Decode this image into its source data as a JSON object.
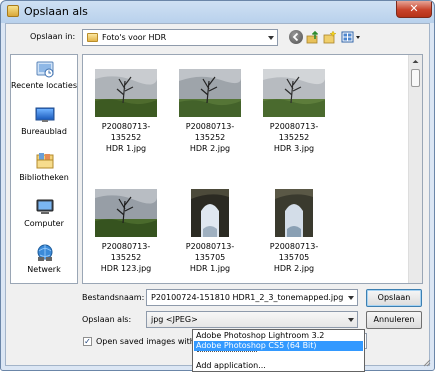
{
  "window": {
    "title": "Opslaan als",
    "close_label": "✕"
  },
  "toolbar": {
    "save_in_label": "Opslaan in:",
    "save_in_value": "Foto's voor HDR"
  },
  "places": [
    {
      "label": "Recente locaties",
      "icon": "recent-places-icon"
    },
    {
      "label": "Bureaublad",
      "icon": "desktop-icon"
    },
    {
      "label": "Bibliotheken",
      "icon": "libraries-icon"
    },
    {
      "label": "Computer",
      "icon": "computer-icon"
    },
    {
      "label": "Netwerk",
      "icon": "network-icon"
    }
  ],
  "files": [
    {
      "line1": "P20080713-135252",
      "line2": "HDR 1.jpg",
      "kind": "tree"
    },
    {
      "line1": "P20080713-135252",
      "line2": "HDR 2.jpg",
      "kind": "tree"
    },
    {
      "line1": "P20080713-135252",
      "line2": "HDR 3.jpg",
      "kind": "tree"
    },
    {
      "line1": "P20080713-135252",
      "line2": "HDR 123.jpg",
      "kind": "tree"
    },
    {
      "line1": "P20080713-135705",
      "line2": "HDR 1.jpg",
      "kind": "arch"
    },
    {
      "line1": "P20080713-135705",
      "line2": "HDR 2.jpg",
      "kind": "arch"
    }
  ],
  "form": {
    "filename_label": "Bestandsnaam:",
    "filename_value": "P20100724-151810 HDR1_2_3_tonemapped.jpg",
    "type_label": "Opslaan als:",
    "type_value": "jpg <JPEG>",
    "save_button": "Opslaan",
    "cancel_button": "Annuleren",
    "open_checkbox_label": "Open saved images with:",
    "open_checked": true
  },
  "dropdown": {
    "items": [
      "Adobe Photoshop Lightroom 3.2",
      "Adobe Photoshop CS5 (64 Bit)",
      "Add application..."
    ],
    "selected_index": 1,
    "separator": "--------------------"
  }
}
